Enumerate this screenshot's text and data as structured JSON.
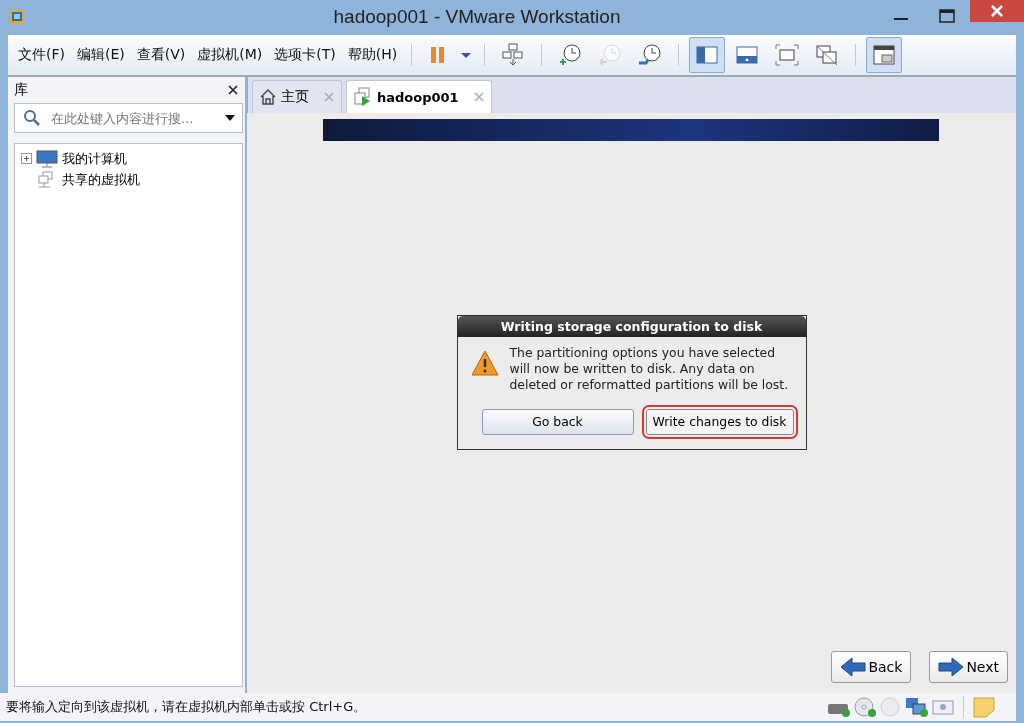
{
  "window": {
    "title": "hadoop001 - VMware Workstation"
  },
  "menu": [
    "文件(F)",
    "编辑(E)",
    "查看(V)",
    "虚拟机(M)",
    "选项卡(T)",
    "帮助(H)"
  ],
  "snapshot_buttons": [
    {
      "disabled": false
    },
    {
      "disabled": true
    },
    {
      "disabled": false
    }
  ],
  "view_buttons": [
    {
      "pressed": true
    },
    {
      "pressed": false
    },
    {
      "pressed": false
    },
    {
      "pressed": false
    }
  ],
  "library_button": {
    "pressed": true
  },
  "library": {
    "title": "库",
    "search": {
      "placeholder": "在此处键入内容进行搜..."
    },
    "items": [
      {
        "label": "我的计算机",
        "kind": "computer",
        "expanded": false
      },
      {
        "label": "共享的虚拟机",
        "kind": "shared"
      }
    ]
  },
  "tabs": [
    {
      "label": "主页",
      "kind": "home",
      "selected": false
    },
    {
      "label": "hadoop001",
      "kind": "vm",
      "selected": true
    }
  ],
  "dialog": {
    "title": "Writing storage configuration to disk",
    "message": "The partitioning options you have selected will now be written to disk.  Any data on deleted or reformatted partitions will be lost.",
    "buttons": [
      {
        "label": "Go back",
        "highlighted": false
      },
      {
        "label": "Write changes to disk",
        "highlighted": true
      }
    ]
  },
  "nav_buttons": [
    {
      "label": "Back",
      "kind": "back"
    },
    {
      "label": "Next",
      "kind": "next"
    }
  ],
  "status_bar": {
    "text": "要将输入定向到该虚拟机，请在虚拟机内部单击或按 Ctrl+G。"
  }
}
